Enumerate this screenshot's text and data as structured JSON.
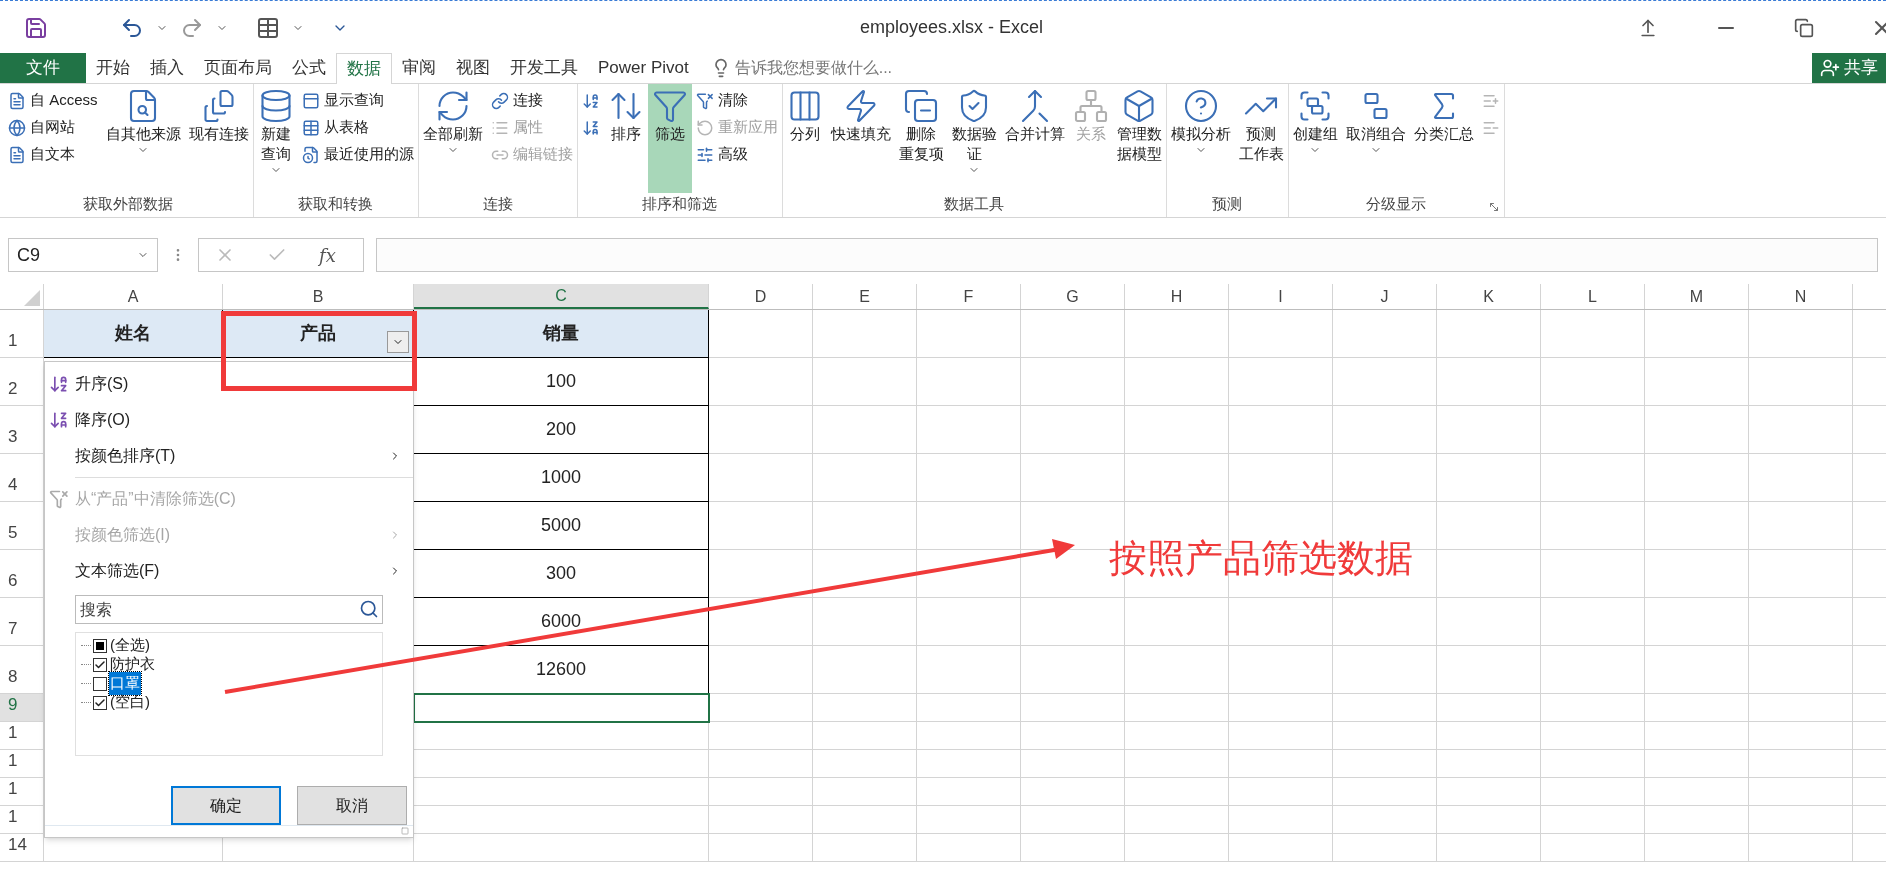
{
  "window": {
    "title": "employees.xlsx - Excel"
  },
  "tabs": [
    {
      "label": "文件",
      "kind": "file",
      "selected": false
    },
    {
      "label": "开始",
      "kind": "tab",
      "selected": false
    },
    {
      "label": "插入",
      "kind": "tab",
      "selected": false
    },
    {
      "label": "页面布局",
      "kind": "tab",
      "selected": false
    },
    {
      "label": "公式",
      "kind": "tab",
      "selected": false
    },
    {
      "label": "数据",
      "kind": "tab",
      "selected": true
    },
    {
      "label": "审阅",
      "kind": "tab",
      "selected": false
    },
    {
      "label": "视图",
      "kind": "tab",
      "selected": false
    },
    {
      "label": "开发工具",
      "kind": "tab",
      "selected": false
    },
    {
      "label": "Power Pivot",
      "kind": "tab",
      "selected": false
    }
  ],
  "tell_me": {
    "placeholder": "告诉我您想要做什么..."
  },
  "share": {
    "label": "共享"
  },
  "ribbon": [
    {
      "label": "获取外部数据",
      "columns": [
        {
          "kind": "stack",
          "items": [
            {
              "label": "自 Access",
              "disabled": false
            },
            {
              "label": "自网站",
              "disabled": false
            },
            {
              "label": "自文本",
              "disabled": false
            }
          ]
        },
        {
          "kind": "large",
          "lines": [
            "自其他来源"
          ],
          "dropdown": true,
          "disabled": false
        },
        {
          "kind": "large",
          "lines": [
            "现有连接"
          ],
          "dropdown": false,
          "disabled": false
        }
      ]
    },
    {
      "label": "获取和转换",
      "columns": [
        {
          "kind": "large",
          "lines": [
            "新建",
            "查询"
          ],
          "dropdown": true,
          "disabled": false
        },
        {
          "kind": "stack",
          "items": [
            {
              "label": "显示查询",
              "disabled": false
            },
            {
              "label": "从表格",
              "disabled": false
            },
            {
              "label": "最近使用的源",
              "disabled": false
            }
          ]
        }
      ]
    },
    {
      "label": "连接",
      "columns": [
        {
          "kind": "large",
          "lines": [
            "全部刷新"
          ],
          "dropdown": true,
          "disabled": false
        },
        {
          "kind": "stack",
          "items": [
            {
              "label": "连接",
              "disabled": false
            },
            {
              "label": "属性",
              "disabled": true
            },
            {
              "label": "编辑链接",
              "disabled": true
            }
          ]
        }
      ]
    },
    {
      "label": "排序和筛选",
      "columns": [
        {
          "kind": "stack",
          "items": [
            {
              "disabled": false
            },
            {
              "disabled": false
            }
          ]
        },
        {
          "kind": "large",
          "lines": [
            "排序"
          ],
          "dropdown": false,
          "disabled": false
        },
        {
          "kind": "large",
          "lines": [
            "筛选"
          ],
          "dropdown": false,
          "disabled": false,
          "on": true
        },
        {
          "kind": "stack",
          "items": [
            {
              "label": "清除",
              "disabled": false
            },
            {
              "label": "重新应用",
              "disabled": true
            },
            {
              "label": "高级",
              "disabled": false
            }
          ]
        }
      ]
    },
    {
      "label": "数据工具",
      "columns": [
        {
          "kind": "large",
          "lines": [
            "分列"
          ],
          "dropdown": false,
          "disabled": false
        },
        {
          "kind": "large",
          "lines": [
            "快速填充"
          ],
          "dropdown": false,
          "disabled": false
        },
        {
          "kind": "large",
          "lines": [
            "删除",
            "重复项"
          ],
          "dropdown": false,
          "disabled": false
        },
        {
          "kind": "large",
          "lines": [
            "数据验",
            "证"
          ],
          "dropdown": true,
          "disabled": false
        },
        {
          "kind": "large",
          "lines": [
            "合并计算"
          ],
          "dropdown": false,
          "disabled": false
        },
        {
          "kind": "large",
          "lines": [
            "关系"
          ],
          "dropdown": false,
          "disabled": true
        },
        {
          "kind": "large",
          "lines": [
            "管理数",
            "据模型"
          ],
          "dropdown": false,
          "disabled": false
        }
      ]
    },
    {
      "label": "预测",
      "columns": [
        {
          "kind": "large",
          "lines": [
            "模拟分析"
          ],
          "dropdown": true,
          "disabled": false
        },
        {
          "kind": "large",
          "lines": [
            "预测",
            "工作表"
          ],
          "dropdown": false,
          "disabled": false
        }
      ]
    },
    {
      "label": "分级显示",
      "columns": [
        {
          "kind": "large",
          "lines": [
            "创建组"
          ],
          "dropdown": true,
          "disabled": false
        },
        {
          "kind": "large",
          "lines": [
            "取消组合"
          ],
          "dropdown": true,
          "disabled": false
        },
        {
          "kind": "large",
          "lines": [
            "分类汇总"
          ],
          "dropdown": false,
          "disabled": false
        },
        {
          "kind": "stack",
          "items": [
            {
              "disabled": true
            },
            {
              "disabled": true
            }
          ]
        }
      ]
    }
  ],
  "formula_bar": {
    "name_box": "C9",
    "function_label": "fx"
  },
  "sheet": {
    "columns": [
      {
        "label": "A",
        "selected": false
      },
      {
        "label": "B",
        "selected": false
      },
      {
        "label": "C",
        "selected": true
      },
      {
        "label": "D",
        "selected": false
      },
      {
        "label": "E",
        "selected": false
      },
      {
        "label": "F",
        "selected": false
      },
      {
        "label": "G",
        "selected": false
      },
      {
        "label": "H",
        "selected": false
      },
      {
        "label": "I",
        "selected": false
      },
      {
        "label": "J",
        "selected": false
      },
      {
        "label": "K",
        "selected": false
      },
      {
        "label": "L",
        "selected": false
      },
      {
        "label": "M",
        "selected": false
      },
      {
        "label": "N",
        "selected": false
      }
    ],
    "rows": [
      {
        "label": "1",
        "selected": false
      },
      {
        "label": "2",
        "selected": false
      },
      {
        "label": "3",
        "selected": false
      },
      {
        "label": "4",
        "selected": false
      },
      {
        "label": "5",
        "selected": false
      },
      {
        "label": "6",
        "selected": false
      },
      {
        "label": "7",
        "selected": false
      },
      {
        "label": "8",
        "selected": false
      },
      {
        "label": "9",
        "selected": true
      },
      {
        "label": "1",
        "selected": false
      },
      {
        "label": "1",
        "selected": false
      },
      {
        "label": "1",
        "selected": false
      },
      {
        "label": "1",
        "selected": false
      },
      {
        "label": "14",
        "selected": false
      }
    ],
    "table_headers": [
      {
        "label": "姓名",
        "filter": false
      },
      {
        "label": "产品",
        "filter": true
      },
      {
        "label": "销量",
        "filter": false
      }
    ],
    "sales": [
      "100",
      "200",
      "1000",
      "5000",
      "300",
      "6000",
      "12600"
    ]
  },
  "filter_menu": {
    "items": [
      {
        "kind": "sort_asc",
        "label": "升序(S)",
        "disabled": false,
        "submenu": false
      },
      {
        "kind": "sort_desc",
        "label": "降序(O)",
        "disabled": false,
        "submenu": false
      },
      {
        "kind": "plain",
        "label": "按颜色排序(T)",
        "disabled": false,
        "submenu": true
      },
      {
        "kind": "separator"
      },
      {
        "kind": "clear",
        "label": "从“产品”中清除筛选(C)",
        "disabled": true,
        "submenu": false
      },
      {
        "kind": "plain",
        "label": "按颜色筛选(I)",
        "disabled": true,
        "submenu": true
      },
      {
        "kind": "plain",
        "label": "文本筛选(F)",
        "disabled": false,
        "submenu": true
      }
    ],
    "search": {
      "placeholder": "搜索"
    },
    "values": [
      {
        "label": "(全选)",
        "checked": false,
        "partial": true,
        "selected": false
      },
      {
        "label": "防护衣",
        "checked": true,
        "selected": false
      },
      {
        "label": "口罩",
        "checked": false,
        "selected": true
      },
      {
        "label": "(空白)",
        "checked": true,
        "selected": false
      }
    ],
    "buttons": [
      {
        "label": "确定",
        "default": true
      },
      {
        "label": "取消",
        "default": false
      }
    ]
  },
  "annotation": {
    "text": "按照产品筛选数据"
  }
}
